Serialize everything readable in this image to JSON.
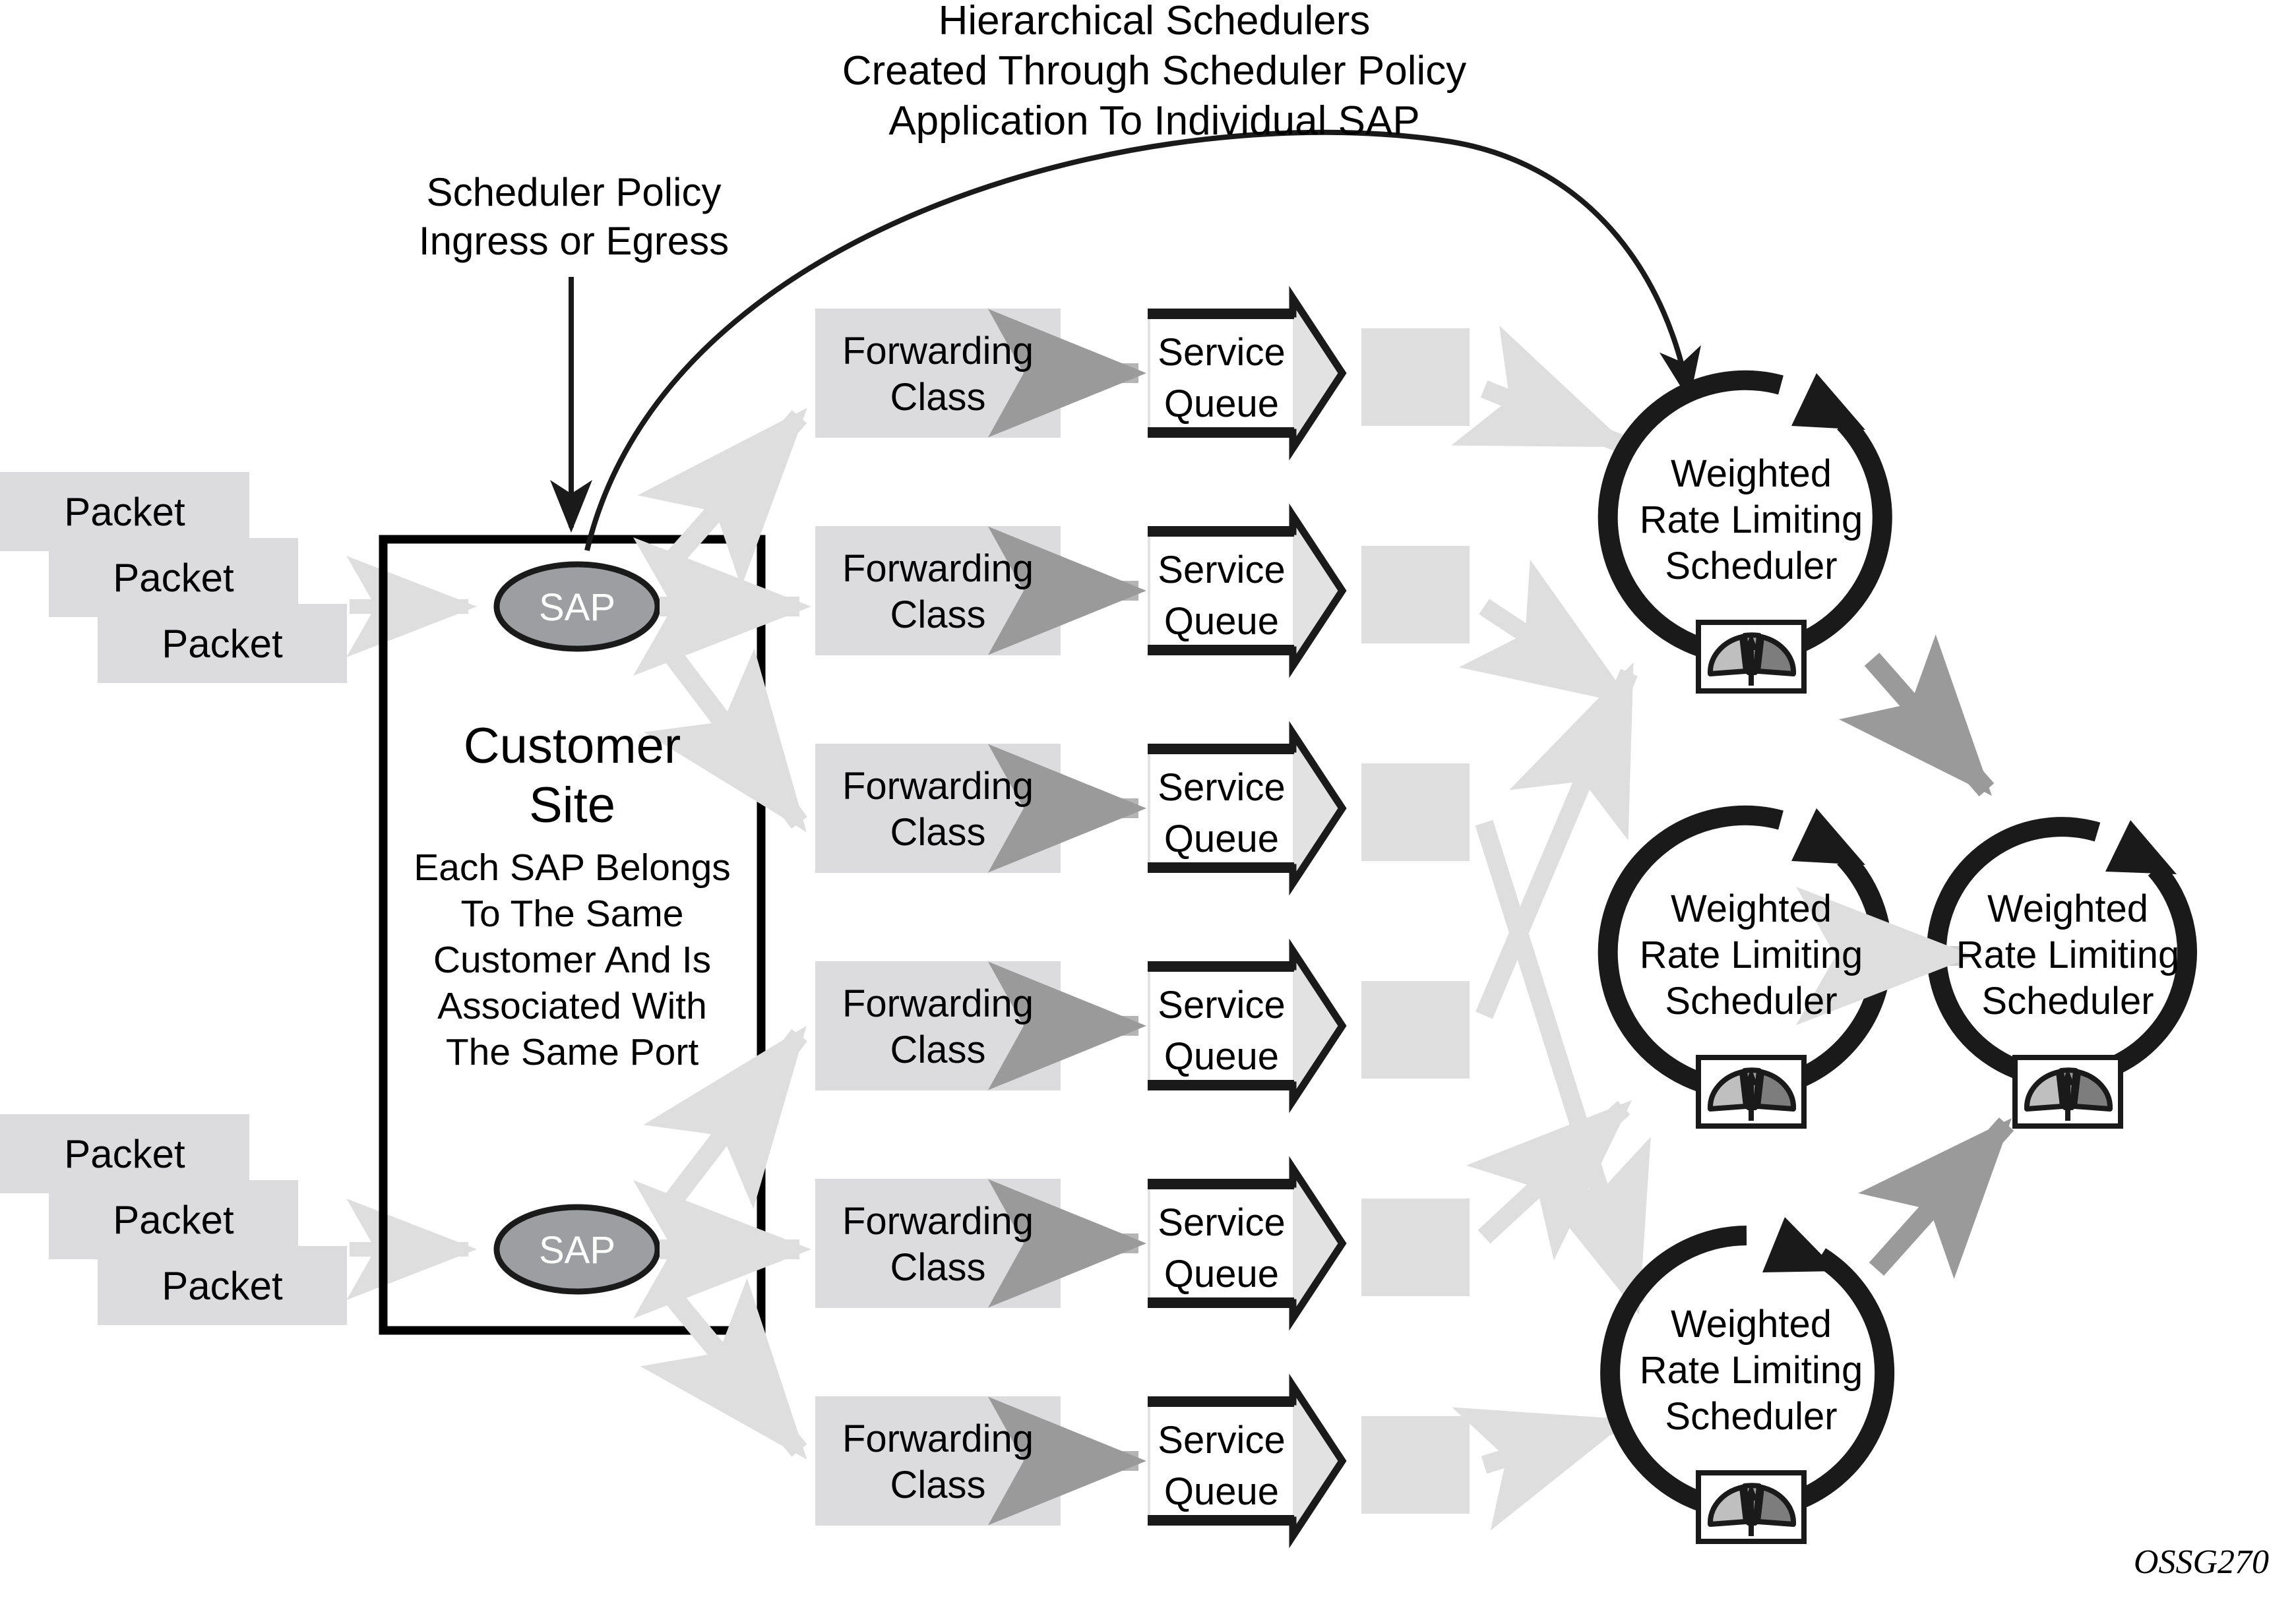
{
  "diagram": {
    "title_lines": [
      "Hierarchical Schedulers",
      "Created Through Scheduler Policy",
      "Application To Individual SAP"
    ],
    "figure_code": "OSSG270",
    "annotation": {
      "lines": [
        "Scheduler Policy",
        "Ingress or Egress"
      ]
    },
    "colors": {
      "box_fill": "#DCDCDE",
      "sap_fill": "#9D9EA1",
      "outline": "#1A1A1A",
      "light_arrow": "#DEDEDE",
      "mid_arrow": "#9A9A9A",
      "queue_fill": "#E2E2E2",
      "gauge_light": "#BFBFBF",
      "gauge_mid": "#9E9E9E",
      "gauge_dark": "#7D7D7D",
      "background": "#FFFFFF"
    }
  },
  "packet_stacks": [
    {
      "labels": [
        "Packet",
        "Packet",
        "Packet"
      ]
    },
    {
      "labels": [
        "Packet",
        "Packet",
        "Packet"
      ]
    }
  ],
  "customer_site": {
    "heading_lines": [
      "Customer",
      "Site"
    ],
    "body_lines": [
      "Each SAP Belongs",
      "To The Same",
      "Customer And Is",
      "Associated With",
      "The Same Port"
    ],
    "saps": [
      {
        "label": "SAP"
      },
      {
        "label": "SAP"
      }
    ]
  },
  "forwarding_classes": [
    {
      "lines": [
        "Forwarding",
        "Class"
      ]
    },
    {
      "lines": [
        "Forwarding",
        "Class"
      ]
    },
    {
      "lines": [
        "Forwarding",
        "Class"
      ]
    },
    {
      "lines": [
        "Forwarding",
        "Class"
      ]
    },
    {
      "lines": [
        "Forwarding",
        "Class"
      ]
    },
    {
      "lines": [
        "Forwarding",
        "Class"
      ]
    }
  ],
  "service_queues": [
    {
      "lines": [
        "Service",
        "Queue"
      ]
    },
    {
      "lines": [
        "Service",
        "Queue"
      ]
    },
    {
      "lines": [
        "Service",
        "Queue"
      ]
    },
    {
      "lines": [
        "Service",
        "Queue"
      ]
    },
    {
      "lines": [
        "Service",
        "Queue"
      ]
    },
    {
      "lines": [
        "Service",
        "Queue"
      ]
    }
  ],
  "schedulers": [
    {
      "lines": [
        "Weighted",
        "Rate Limiting",
        "Scheduler"
      ],
      "position": "top"
    },
    {
      "lines": [
        "Weighted",
        "Rate Limiting",
        "Scheduler"
      ],
      "position": "middle"
    },
    {
      "lines": [
        "Weighted",
        "Rate Limiting",
        "Scheduler"
      ],
      "position": "right"
    },
    {
      "lines": [
        "Weighted",
        "Rate Limiting",
        "Scheduler"
      ],
      "position": "bottom"
    }
  ]
}
